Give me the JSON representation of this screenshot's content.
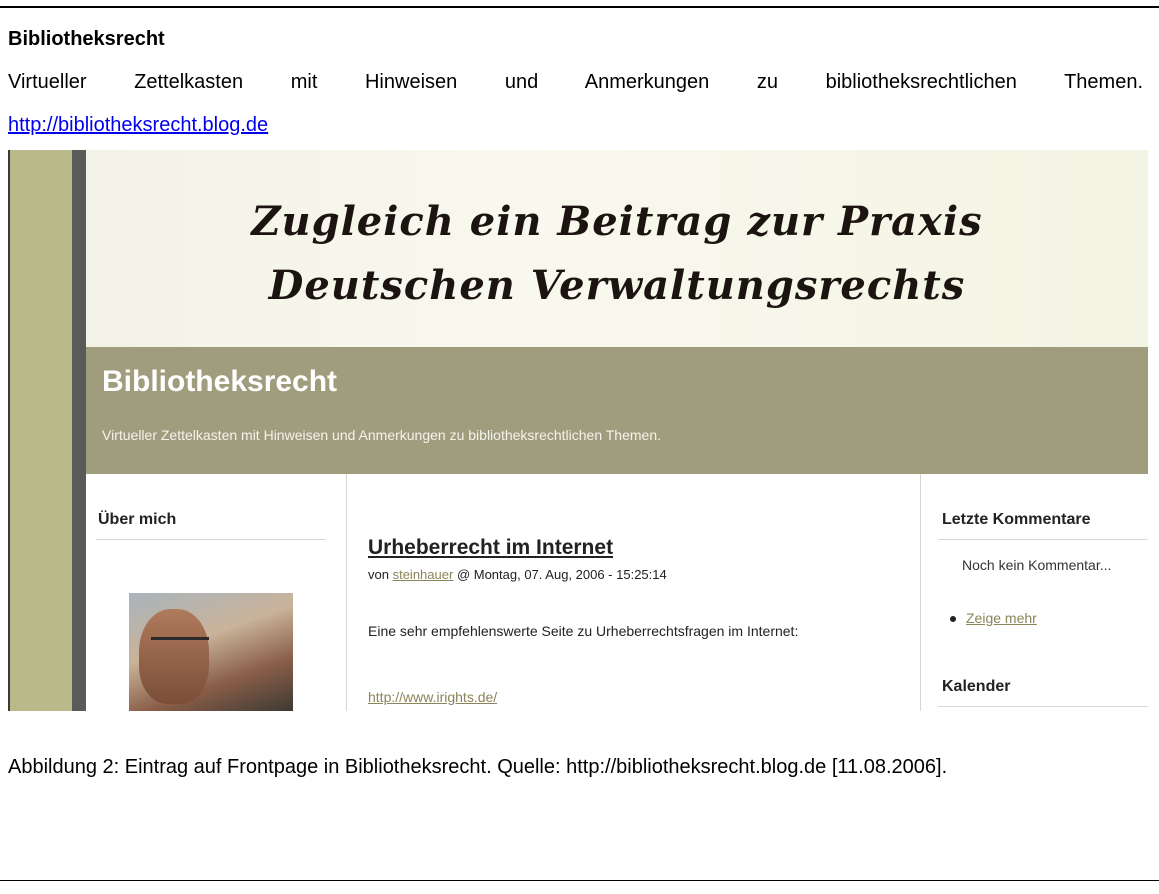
{
  "doc": {
    "title": "Bibliotheksrecht",
    "description": "Virtueller Zettelkasten mit Hinweisen und Anmerkungen zu bibliotheksrechtlichen Themen.",
    "url": "http://bibliotheksrecht.blog.de"
  },
  "screenshot": {
    "header_image": {
      "line1": "Zugleich ein Beitrag zur Praxis",
      "line2": "Deutschen Verwaltungsrechts"
    },
    "banner": {
      "title": "Bibliotheksrecht",
      "subtitle": "Virtueller Zettelkasten mit Hinweisen und Anmerkungen zu bibliotheksrechtlichen Themen."
    },
    "left_sidebar": {
      "heading": "Über mich"
    },
    "post": {
      "title": "Urheberrecht im Internet",
      "meta_prefix": "von",
      "author": "steinhauer",
      "meta_suffix": "@ Montag, 07. Aug, 2006 - 15:25:14",
      "body": "Eine sehr empfehlenswerte Seite zu Urheberrechtsfragen im Internet:",
      "link": "http://www.irights.de/"
    },
    "right_sidebar": {
      "comments_heading": "Letzte Kommentare",
      "no_comments": "Noch kein Kommentar...",
      "more_link": "Zeige mehr",
      "calendar_heading": "Kalender"
    }
  },
  "caption": "Abbildung 2: Eintrag auf Frontpage in Bibliotheksrecht. Quelle: http://bibliotheksrecht.blog.de [11.08.2006].",
  "colors": {
    "banner": "#a09d7f",
    "left_band": "#b9b98a",
    "link_doc": "#0000ee",
    "link_blog": "#8a8458"
  }
}
